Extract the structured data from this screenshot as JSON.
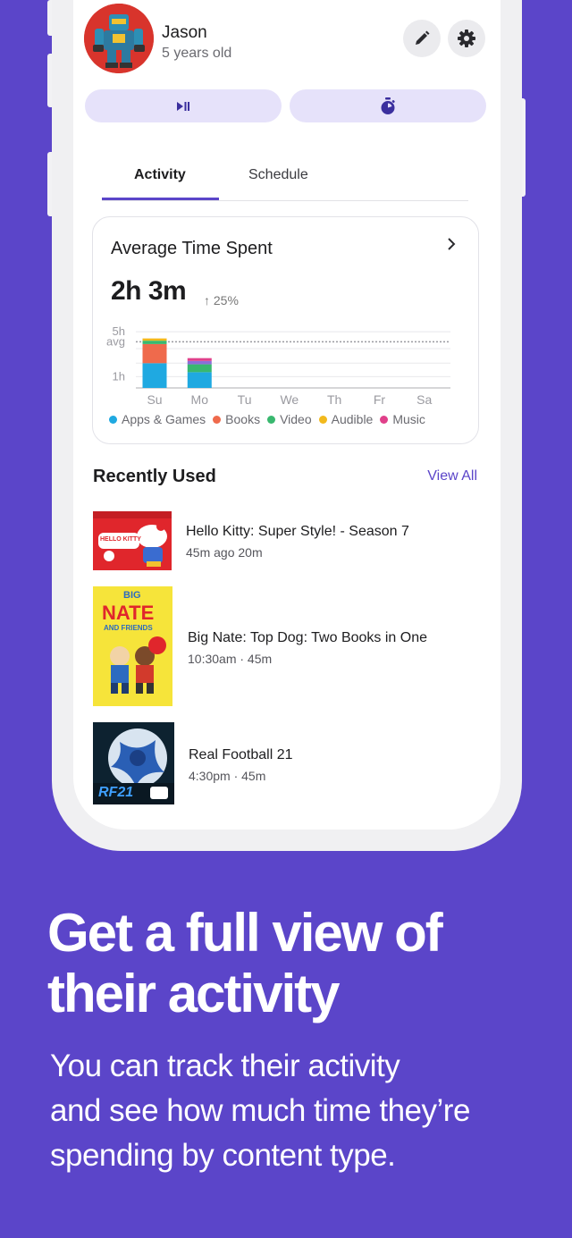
{
  "profile": {
    "name": "Jason",
    "age": "5 years old"
  },
  "header_buttons": {
    "edit_icon": "pencil-icon",
    "settings_icon": "gear-icon",
    "play_icon": "play-pause-icon",
    "timer_icon": "stopwatch-icon"
  },
  "tabs": [
    {
      "label": "Activity",
      "active": true
    },
    {
      "label": "Schedule",
      "active": false
    }
  ],
  "summary_card": {
    "title": "Average Time Spent",
    "total": "2h 3m",
    "change": "25%"
  },
  "chart_data": {
    "type": "bar",
    "stacked": true,
    "categories": [
      "Su",
      "Mo",
      "Tu",
      "We",
      "Th",
      "Fr",
      "Sa"
    ],
    "y_tick_labels": [
      "5h",
      "avg",
      "1h"
    ],
    "series": [
      {
        "name": "Apps & Games",
        "color": "#1fa9e1",
        "values": [
          2.2,
          1.4,
          0,
          0,
          0,
          0,
          0
        ]
      },
      {
        "name": "Books",
        "color": "#ef6a4c",
        "values": [
          1.7,
          0,
          0,
          0,
          0,
          0,
          0
        ]
      },
      {
        "name": "Video",
        "color": "#39b86f",
        "values": [
          0.3,
          0.7,
          0,
          0,
          0,
          0,
          0
        ]
      },
      {
        "name": "Audible",
        "color": "#f2b91c",
        "values": [
          0.2,
          0,
          0,
          0,
          0,
          0,
          0
        ]
      },
      {
        "name": "Music",
        "color": "#e0408a",
        "values": [
          0,
          0.25,
          0,
          0,
          0,
          0,
          0
        ]
      }
    ],
    "extra_segment": {
      "day": "Mo",
      "color": "#8b6fd8",
      "value": 0.3
    },
    "ylim": [
      0,
      5.8
    ],
    "avg_line": 4.1
  },
  "legend": [
    "Apps & Games",
    "Books",
    "Video",
    "Audible",
    "Music"
  ],
  "recent": {
    "title": "Recently Used",
    "view_all": "View All",
    "items": [
      {
        "title": "Hello Kitty: Super Style! - Season 7",
        "meta": "45m ago  20m"
      },
      {
        "title": "Big Nate: Top Dog: Two Books in One",
        "meta": "10:30am  ·  45m"
      },
      {
        "title": "Real Football 21",
        "meta": "4:30pm  ·  45m"
      }
    ],
    "thumbs": {
      "hello_kitty": "HELLO KITTY",
      "big_nate_top": "BIG",
      "big_nate_main": "NATE",
      "big_nate_sub": "AND FRIENDS",
      "rf21": "RF21"
    }
  },
  "promo": {
    "headline_line1": "Get a full view of",
    "headline_line2": "their activity",
    "sub_line1": "You can track their activity",
    "sub_line2": "and see how much time they’re",
    "sub_line3": "spending by content type."
  }
}
